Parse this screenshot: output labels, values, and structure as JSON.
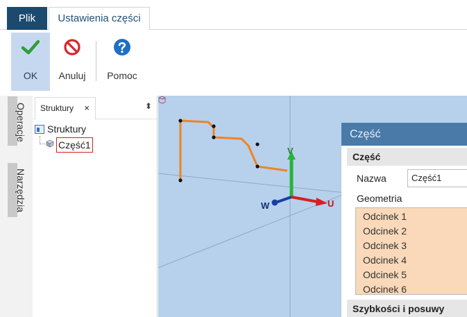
{
  "menu": {
    "file_tab": "Plik",
    "settings_tab": "Ustawienia części"
  },
  "ribbon": {
    "ok_label": "OK",
    "cancel_label": "Anuluj",
    "help_label": "Pomoc"
  },
  "side_tabs": {
    "operations": "Operacje",
    "tools": "Narzędzia"
  },
  "structure_panel": {
    "tab_label": "Struktury",
    "close_glyph": "×",
    "pin_glyph": "⬍",
    "root_label": "Struktury",
    "child_label": "Część1"
  },
  "viewport": {
    "axis_v": "V",
    "axis_u": "U",
    "axis_w": "W"
  },
  "dialog": {
    "title": "Część",
    "section_part": "Część",
    "name_label": "Nazwa",
    "name_value": "Część1",
    "geometry_label": "Geometria",
    "geometry_items": [
      "Odcinek 1",
      "Odcinek 2",
      "Odcinek 3",
      "Odcinek 4",
      "Odcinek 5",
      "Odcinek 6"
    ],
    "section_speeds": "Szybkości i posuwy"
  },
  "colors": {
    "file_tab_bg": "#1c4a6f",
    "ok_button_bg": "#c6d8ef",
    "viewport_bg": "#b7d0ec",
    "dialog_title_bg": "#4a7aa8",
    "geometry_list_bg": "#f9d9b9",
    "path_color": "#f0841e",
    "selection_border": "#d21f1f"
  },
  "icons": {
    "ok": "checkmark-icon",
    "cancel": "prohibited-icon",
    "help": "question-icon"
  }
}
